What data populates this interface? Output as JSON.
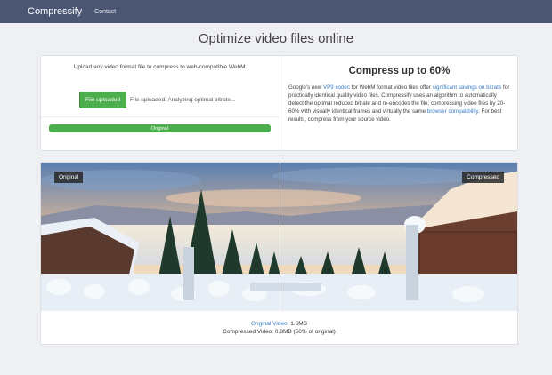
{
  "navbar": {
    "brand": "Compressify",
    "links": [
      "Contact"
    ]
  },
  "page_title": "Optimize video files online",
  "upload": {
    "hint": "Upload any video format file to compress to web-compatible WebM.",
    "button_label": "File uploaded",
    "status": "File uploaded. Analyzing optimal bitrate...",
    "progress_label": "Original",
    "progress_value": 1.0
  },
  "info": {
    "heading": "Compress up to 60%",
    "desc_1": "Google's new ",
    "link_vp9": "VP9 codec",
    "desc_2": " for WebM format video files offer ",
    "link_savings": "significant savings on bitrate",
    "desc_3": " for practically identical quality video files. Compressify uses an algorithm to automatically detect the optimal reduced bitrate and re-encodes the file, compressing video files by 20-60% with visually identical frames and virtually the same ",
    "link_compat": "browser compatibility",
    "desc_4": ". For best results, compress from your source video."
  },
  "compare": {
    "label_left": "Original",
    "label_right": "Compressed",
    "original_link": "Original Video",
    "original_size": ": 1.6MB",
    "compressed_text": "Compressed Video: 0.8MB (50% of original)"
  },
  "colors": {
    "navbar": "#4b5673",
    "accent_green": "#4cae4c",
    "link_blue": "#3b7dc4",
    "background": "#eef0f3"
  }
}
